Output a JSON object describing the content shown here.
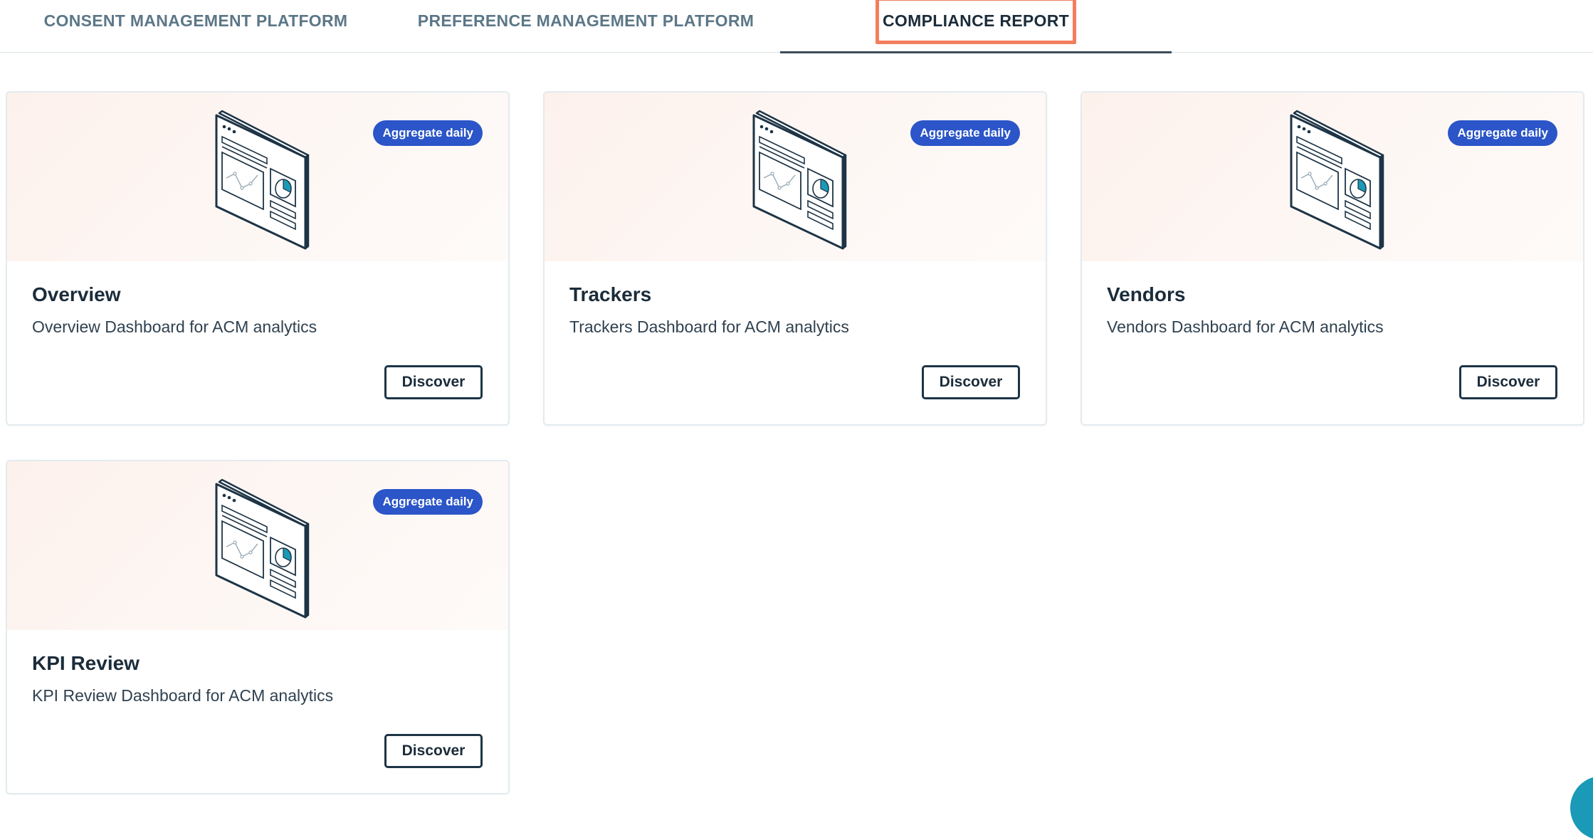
{
  "tabs": [
    {
      "label": "CONSENT MANAGEMENT PLATFORM"
    },
    {
      "label": "PREFERENCE MANAGEMENT PLATFORM"
    },
    {
      "label": "COMPLIANCE REPORT",
      "active": true
    }
  ],
  "colors": {
    "badge": "#2b55c8",
    "highlight": "#f37e5e",
    "hero_background": "#fdf3ef",
    "text_dark": "#1b2c3a",
    "tab_inactive": "#5c7787"
  },
  "cards": [
    {
      "title": "Overview",
      "description": "Overview Dashboard for ACM analytics",
      "badge": "Aggregate daily",
      "button": "Discover",
      "icon": "dashboard-illustration-icon"
    },
    {
      "title": "Trackers",
      "description": "Trackers Dashboard for ACM analytics",
      "badge": "Aggregate daily",
      "button": "Discover",
      "icon": "dashboard-illustration-icon"
    },
    {
      "title": "Vendors",
      "description": "Vendors Dashboard for ACM analytics",
      "badge": "Aggregate daily",
      "button": "Discover",
      "icon": "dashboard-illustration-icon"
    },
    {
      "title": "KPI Review",
      "description": "KPI Review Dashboard for ACM analytics",
      "badge": "Aggregate daily",
      "button": "Discover",
      "icon": "dashboard-illustration-icon"
    }
  ]
}
